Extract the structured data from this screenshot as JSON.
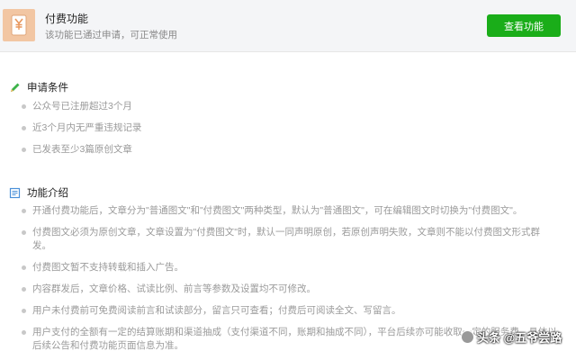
{
  "header": {
    "title": "付费功能",
    "desc": "该功能已通过申请，可正常使用",
    "button_label": "查看功能",
    "icon": "yuan-document-icon",
    "accent_color": "#1aad19"
  },
  "conditions": {
    "title": "申请条件",
    "icon": "pencil-icon",
    "items": [
      "公众号已注册超过3个月",
      "近3个月内无严重违规记录",
      "已发表至少3篇原创文章"
    ]
  },
  "intro": {
    "title": "功能介绍",
    "icon": "document-icon",
    "items": [
      "开通付费功能后，文章分为\"普通图文\"和\"付费图文\"两种类型，默认为\"普通图文\"，可在编辑图文时切换为\"付费图文\"。",
      "付费图文必须为原创文章，文章设置为\"付费图文\"时，默认一同声明原创，若原创声明失败，文章则不能以付费图文形式群发。",
      "付费图文暂不支持转载和插入广告。",
      "内容群发后，文章价格、试读比例、前言等参数及设置均不可修改。",
      "用户未付费前可免费阅读前言和试读部分，留言只可查看；付费后可阅读全文、写留言。",
      "用户支付的全额有一定的结算账期和渠道抽成（支付渠道不同，账期和抽成不同），平台后续亦可能收取一定的服务费，具体以后续公告和付费功能页面信息为准。"
    ]
  },
  "watermark": {
    "text": "头条 @五爷尝路"
  }
}
